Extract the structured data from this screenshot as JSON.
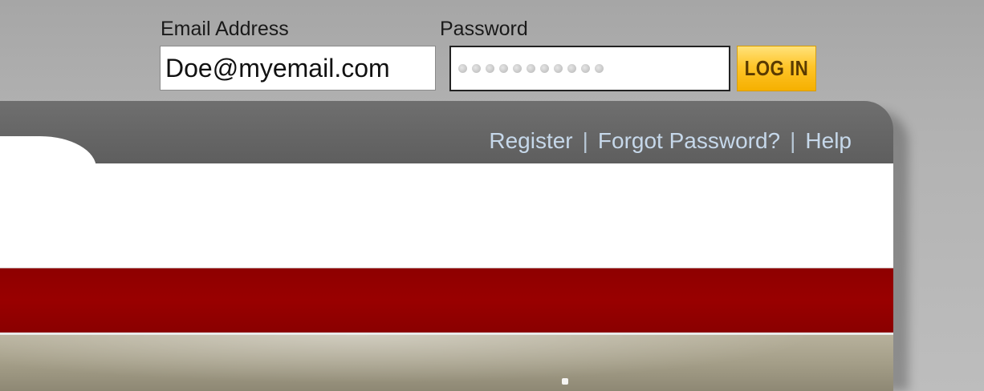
{
  "login": {
    "email_label": "Email Address",
    "password_label": "Password",
    "email_value": "Doe@myemail.com",
    "password_masked_count": 11,
    "login_button_label": "LOG IN"
  },
  "header": {
    "links": {
      "register": "Register",
      "forgot_password": "Forgot Password?",
      "help": "Help",
      "separator": "|"
    }
  },
  "colors": {
    "header_gray": "#666666",
    "red_bar": "#990000",
    "login_button": "#ffc52a",
    "link_text": "#c6d8ea"
  }
}
